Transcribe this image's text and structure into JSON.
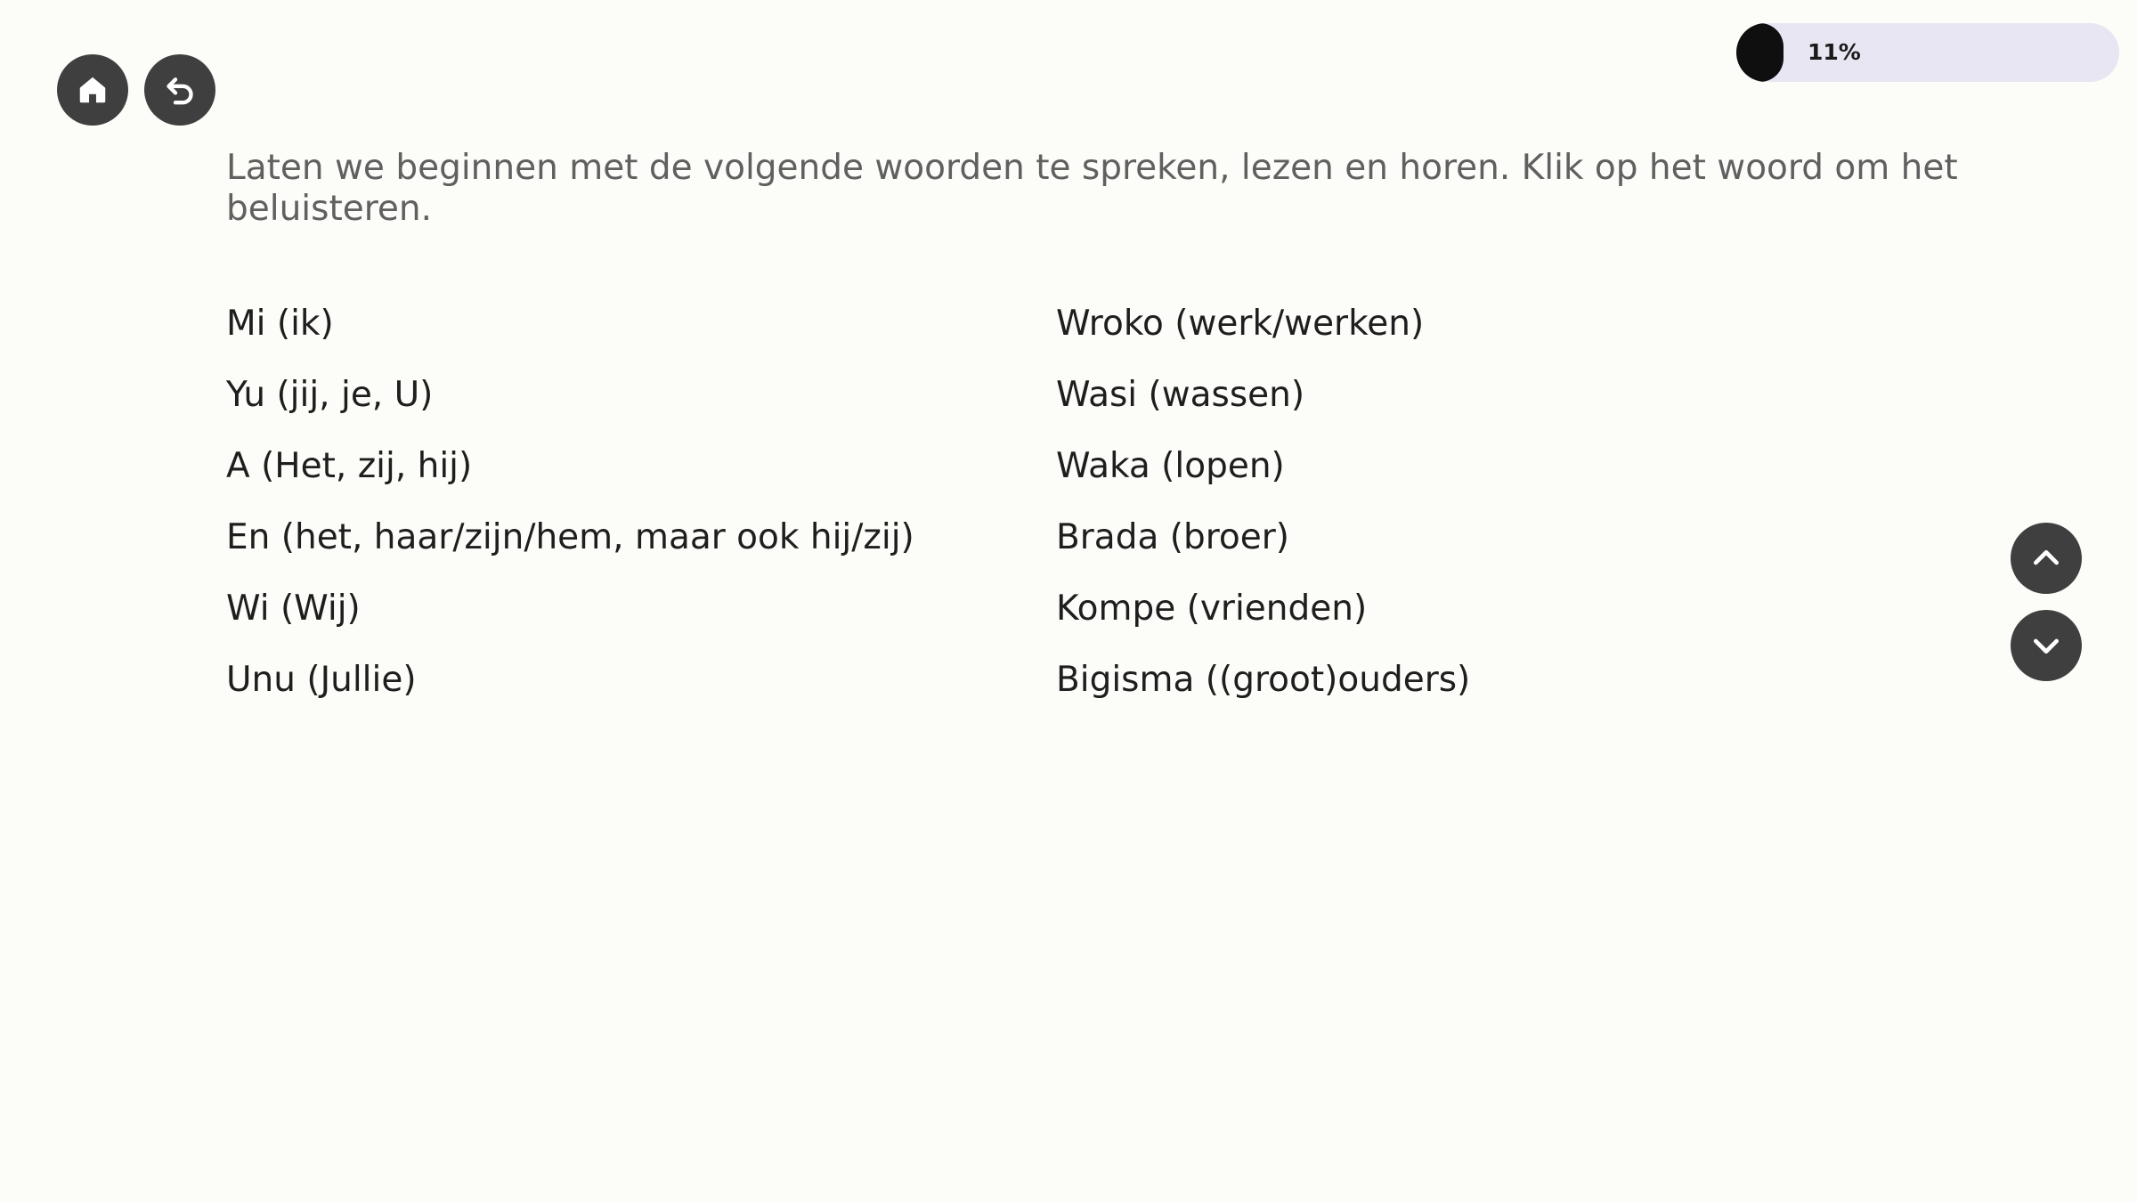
{
  "progress": {
    "label": "11%",
    "value": 0.11
  },
  "intro_text": "Laten we beginnen met de volgende woorden te spreken, lezen en horen. Klik op het woord om het beluisteren.",
  "words_left": [
    "Mi (ik)",
    "Yu (jij, je, U)",
    "A (Het, zij, hij)",
    "En (het, haar/zijn/hem, maar ook hij/zij)",
    "Wi (Wij)",
    "Unu (Jullie)"
  ],
  "words_right": [
    "Wroko (werk/werken)",
    "Wasi (wassen)",
    "Waka (lopen)",
    "Brada (broer)",
    "Kompe (vrienden)",
    "Bigisma ((groot)ouders)"
  ],
  "icons": {
    "home": "home-icon",
    "back": "undo-arrow-icon",
    "scroll_up": "chevron-up-icon",
    "scroll_down": "chevron-down-icon"
  },
  "colors": {
    "background": "#fcfcf8",
    "button": "#3f3f3f",
    "progress_track": "#e7e6f2",
    "progress_fill": "#0f0f0f"
  }
}
